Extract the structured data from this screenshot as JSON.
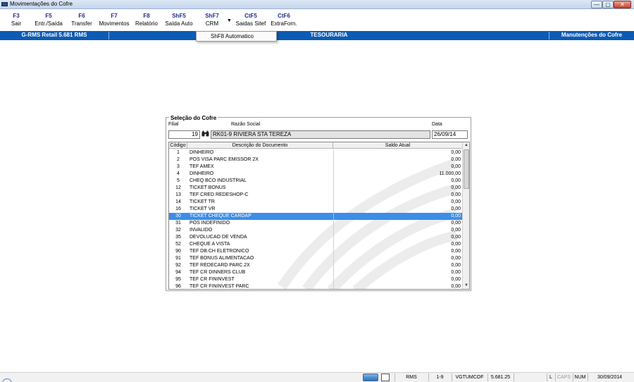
{
  "window": {
    "title": "Movimentações do Cofre",
    "min_glyph": "—",
    "max_glyph": "▢",
    "close_glyph": "✕"
  },
  "toolbar": {
    "buttons": [
      {
        "key": "F3",
        "label": "Sair"
      },
      {
        "key": "F5",
        "label": "Entr./Saída"
      },
      {
        "key": "F6",
        "label": "Transfer"
      },
      {
        "key": "F7",
        "label": "Movimentos"
      },
      {
        "key": "F8",
        "label": "Relatório"
      },
      {
        "key": "ShF5",
        "label": "Saída Auto"
      },
      {
        "key": "ShF7",
        "label": "CRM"
      },
      {
        "key": "CtF5",
        "label": "Saidas Sitef"
      },
      {
        "key": "CtF6",
        "label": "ExtraForn."
      }
    ],
    "dropdown_arrow": "▼"
  },
  "dropdown_menu": {
    "item": "ShF8  Automatico"
  },
  "header": {
    "version": "G-RMS Retail 5.681 RMS",
    "section": "TESOURARIA",
    "right": "Manutenções do Cofre"
  },
  "panel": {
    "legend": "Seleção do Cofre",
    "filial_label": "Filial",
    "filial_value": "19",
    "razao_label": "Razão Social",
    "razao_value": "RK01-9 RIVIERA STA TEREZA",
    "data_label": "Data",
    "data_value": "26/09/14",
    "binoculars_icon": "binoculars-icon"
  },
  "grid": {
    "columns": {
      "codigo": "Código",
      "descricao": "Descrição do Documento",
      "saldo": "Saldo Atual"
    },
    "rows": [
      {
        "codigo": "1",
        "descricao": "DINHEIRO",
        "saldo": "0,00"
      },
      {
        "codigo": "2",
        "descricao": "POS VISA PARC EMISSOR  2X",
        "saldo": "0,00"
      },
      {
        "codigo": "3",
        "descricao": "TEF AMEX",
        "saldo": "0,00"
      },
      {
        "codigo": "4",
        "descricao": "DINHEIRO",
        "saldo": "11.000,00"
      },
      {
        "codigo": "5",
        "descricao": "CHEQ BCO INDUSTRIAL",
        "saldo": "0,00"
      },
      {
        "codigo": "12",
        "descricao": "TICKET BONUS",
        "saldo": "0,00"
      },
      {
        "codigo": "13",
        "descricao": "TEF CRED REDESHOP-C",
        "saldo": "0,00"
      },
      {
        "codigo": "14",
        "descricao": "TICKET TR",
        "saldo": "0,00"
      },
      {
        "codigo": "16",
        "descricao": "TICKET VR",
        "saldo": "0,00"
      },
      {
        "codigo": "30",
        "descricao": "TICKET CHEQUE CARDAP",
        "saldo": "0,00",
        "selected": true
      },
      {
        "codigo": "31",
        "descricao": "POS INDEFINIDO",
        "saldo": "0,00"
      },
      {
        "codigo": "32",
        "descricao": "INVALIDO",
        "saldo": "0,00"
      },
      {
        "codigo": "35",
        "descricao": "DEVOLUCAO DE VENDA",
        "saldo": "0,00"
      },
      {
        "codigo": "52",
        "descricao": "CHEQUE A VISTA",
        "saldo": "0,00"
      },
      {
        "codigo": "90",
        "descricao": "TEF DB.CH ELETRONICO",
        "saldo": "0,00"
      },
      {
        "codigo": "91",
        "descricao": "TEF BONUS ALIMENTACAO",
        "saldo": "0,00"
      },
      {
        "codigo": "92",
        "descricao": "TEF REDECARD PARC.2X",
        "saldo": "0,00"
      },
      {
        "codigo": "94",
        "descricao": "TEF CR DINNERS CLUB",
        "saldo": "0,00"
      },
      {
        "codigo": "95",
        "descricao": "TEF CR FININVEST",
        "saldo": "0,00"
      },
      {
        "codigo": "96",
        "descricao": "TEF CR FININVEST PARC",
        "saldo": "0,00"
      }
    ],
    "scroll_up": "▲",
    "scroll_down": "▼"
  },
  "statusbar": {
    "fields": [
      "RMS",
      "1-9",
      "VGTUMCOF",
      "5.681.25",
      "",
      "L",
      "CAPS",
      "NUM",
      "30/09/2014"
    ]
  },
  "colors": {
    "header_blue": "#0c5bb5",
    "selection_blue": "#3b8ee8",
    "toolbar_key": "#1a2f8a"
  }
}
